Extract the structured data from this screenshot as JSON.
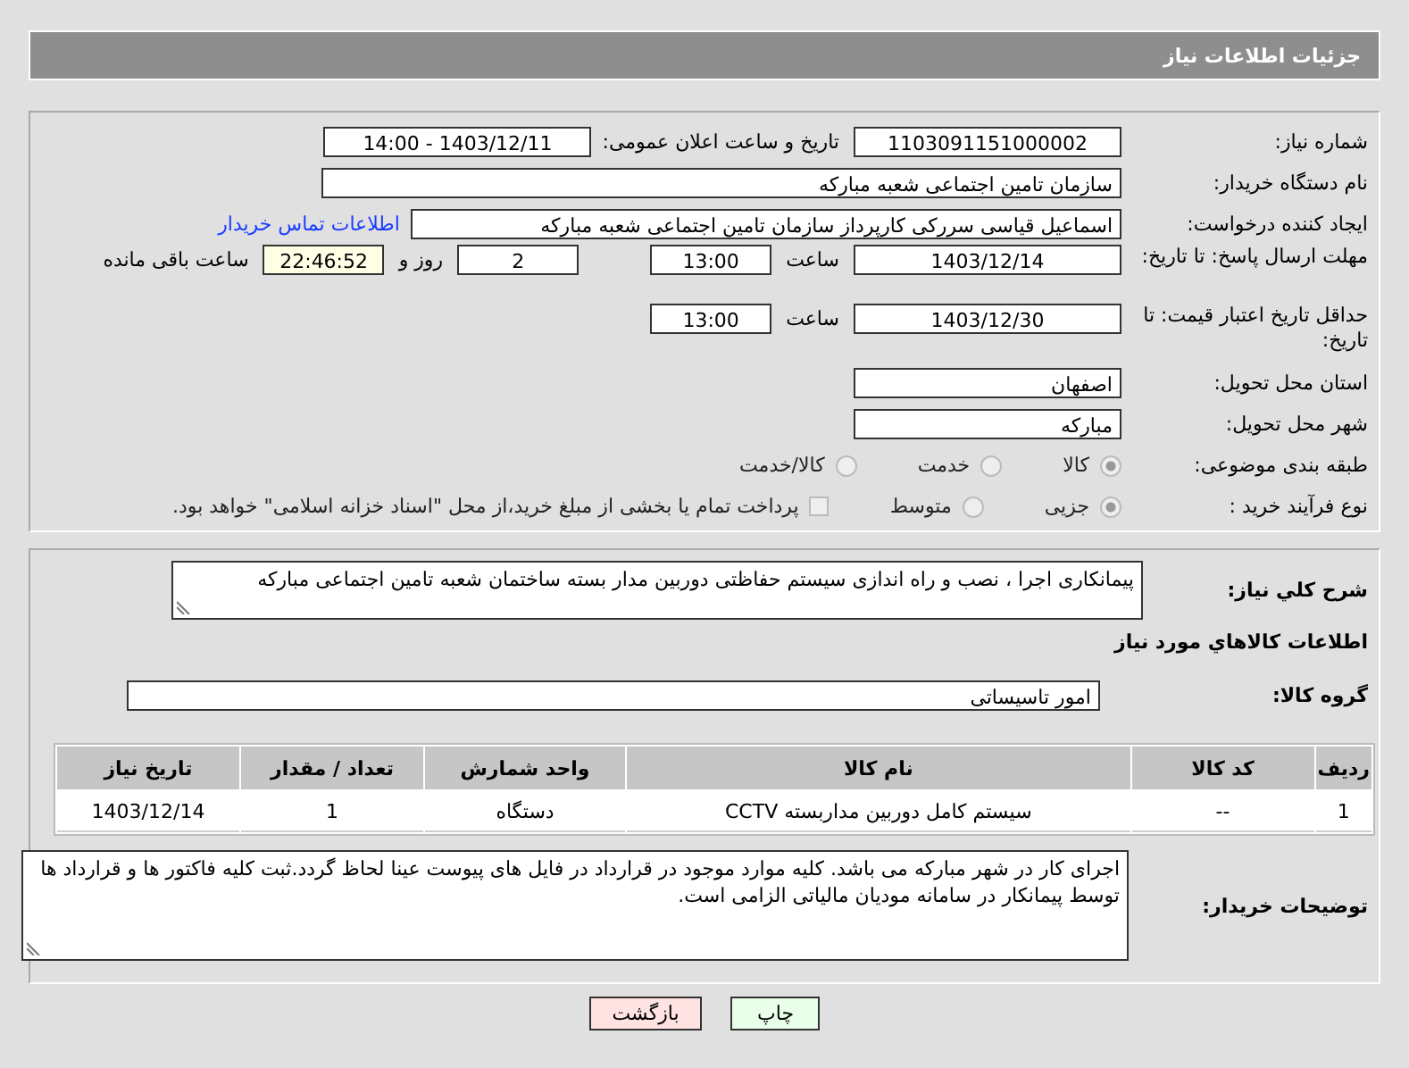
{
  "header": {
    "title": "جزئیات اطلاعات نیاز"
  },
  "need_number": {
    "label": "شماره نیاز:",
    "value": "1103091151000002"
  },
  "announce": {
    "label": "تاریخ و ساعت اعلان عمومی:",
    "value": "1403/12/11 - 14:00"
  },
  "buyer": {
    "label": "نام دستگاه خریدار:",
    "value": "سازمان تامین اجتماعی شعبه مبارکه"
  },
  "creator": {
    "label": "ایجاد کننده درخواست:",
    "value": "اسماعیل قیاسی سررکی کارپرداز سازمان تامین اجتماعی شعبه مبارکه",
    "link": "اطلاعات تماس خریدار"
  },
  "reply_deadline": {
    "label": "مهلت ارسال پاسخ: تا تاریخ:",
    "date": "1403/12/14",
    "time_label": "ساعت",
    "time": "13:00",
    "days": "2",
    "days_label": "روز و",
    "remaining": "22:46:52",
    "remaining_label": "ساعت باقی مانده"
  },
  "price_validity": {
    "label": "حداقل تاریخ اعتبار قیمت: تا تاریخ:",
    "date": "1403/12/30",
    "time_label": "ساعت",
    "time": "13:00"
  },
  "province": {
    "label": "استان محل تحویل:",
    "value": "اصفهان"
  },
  "city": {
    "label": "شهر محل تحویل:",
    "value": "مبارکه"
  },
  "category": {
    "label": "طبقه بندی موضوعی:",
    "options": [
      {
        "kind": "radio",
        "label": "کالا",
        "selected": true
      },
      {
        "kind": "radio",
        "label": "خدمت",
        "selected": false
      },
      {
        "kind": "radio",
        "label": "کالا/خدمت",
        "selected": false
      }
    ]
  },
  "process": {
    "label": "نوع فرآیند خرید :",
    "options": [
      {
        "kind": "radio",
        "label": "جزیی",
        "selected": true
      },
      {
        "kind": "radio",
        "label": "متوسط",
        "selected": false
      },
      {
        "kind": "checkbox",
        "label": "پرداخت تمام یا بخشی از مبلغ خرید،از محل \"اسناد خزانه اسلامی\" خواهد بود.",
        "checked": false
      }
    ]
  },
  "description": {
    "label": "شرح کلي نياز:",
    "value": "پیمانکاری اجرا ، نصب  و راه اندازی سیستم حفاظتی دوربین مدار بسته ساختمان شعبه تامین اجتماعی مبارکه"
  },
  "goods_title": "اطلاعات كالاهاي مورد نياز",
  "goods_group": {
    "label": "گروه كالا:",
    "value": "امور تاسیساتی"
  },
  "table": {
    "columns": [
      "ردیف",
      "کد کالا",
      "نام کالا",
      "واحد شمارش",
      "تعداد / مقدار",
      "تاریخ نیاز"
    ],
    "rows": [
      [
        "1",
        "--",
        "سیستم کامل دوربین مداربسته CCTV",
        "دستگاه",
        "1",
        "1403/12/14"
      ]
    ]
  },
  "buyer_notes": {
    "label": "توضیحات خریدار:",
    "value": "اجرای کار در شهر مبارکه می باشد. کلیه موارد موجود در قرارداد در فایل های پیوست عینا لحاظ گردد.ثبت کلیه فاکتور ها و قرارداد ها توسط پیمانکار در سامانه مودیان مالیاتی الزامی است."
  },
  "buttons": [
    {
      "kind": "print",
      "label": "چاپ"
    },
    {
      "kind": "back",
      "label": "بازگشت"
    }
  ]
}
